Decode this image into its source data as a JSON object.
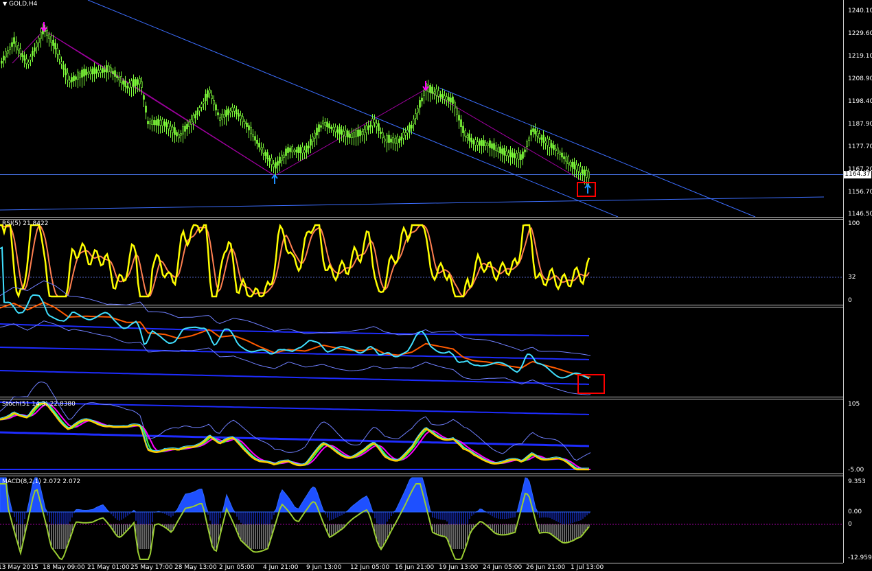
{
  "symbol": {
    "label": "GOLD,H4",
    "dropdown_icon": "triangle-down-icon"
  },
  "current_price": "1164.37",
  "price_axis": [
    "1240.10",
    "1229.60",
    "1219.10",
    "1208.90",
    "1198.40",
    "1187.90",
    "1177.70",
    "1167.20",
    "1156.70",
    "1146.50"
  ],
  "rsi": {
    "title": "RSI(5) 21.8422",
    "levels": [
      "100",
      "32",
      "0"
    ]
  },
  "stoch": {
    "title": "Stoch(51 14.3) 22.8380",
    "levels": [
      "105",
      "-5.00"
    ]
  },
  "macd": {
    "title": "MACD(8,2,1) 2.072 2.072",
    "levels": [
      "9.353",
      "0.00",
      "0",
      "-12.959"
    ]
  },
  "time_axis": [
    "13 May 2015",
    "18 May 09:00",
    "21 May 01:00",
    "25 May 17:00",
    "28 May 13:00",
    "2 Jun 05:00",
    "4 Jun 21:00",
    "9 Jun 13:00",
    "12 Jun 05:00",
    "16 Jun 21:00",
    "19 Jun 13:00",
    "24 Jun 05:00",
    "26 Jun 21:00",
    "1 Jul 13:00"
  ],
  "colors": {
    "background": "#000000",
    "bull_candle": "#7fff3a",
    "trendline": "#3c6eff",
    "zigzag": "#b000b0",
    "rsi_line": "#ffff00",
    "rsi_signal": "#ff7f50",
    "macd_hist": "#1e3cff",
    "macd_signal": "#9acd32",
    "arrow_down": "#ff00ff",
    "arrow_up": "#1e90ff",
    "highlight_box": "#ff0000"
  }
}
